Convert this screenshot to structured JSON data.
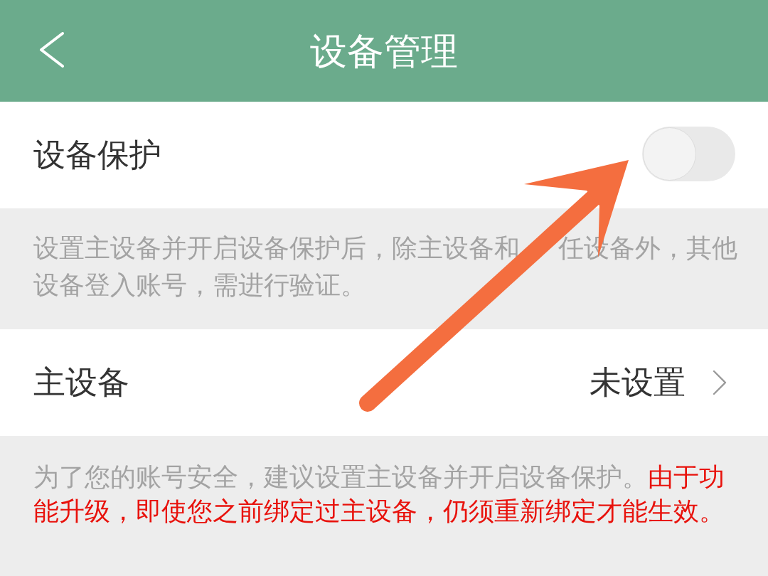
{
  "header": {
    "title": "设备管理"
  },
  "sections": [
    {
      "kind": "toggle",
      "label": "设备保护",
      "on": false
    },
    {
      "kind": "note",
      "parts": [
        "设置主设备并开启设备保护后，除主设备和",
        "任设备外，其他设备登入账号，需进行验证。"
      ]
    },
    {
      "kind": "link",
      "label": "主设备",
      "value": "未设置"
    },
    {
      "kind": "warning_note",
      "text": "为了您的账号安全，建议设置主设备并开启设备保护。",
      "warning": "由于功能升级，即使您之前绑定过主设备，仍须重新绑定才能生效。"
    }
  ]
}
